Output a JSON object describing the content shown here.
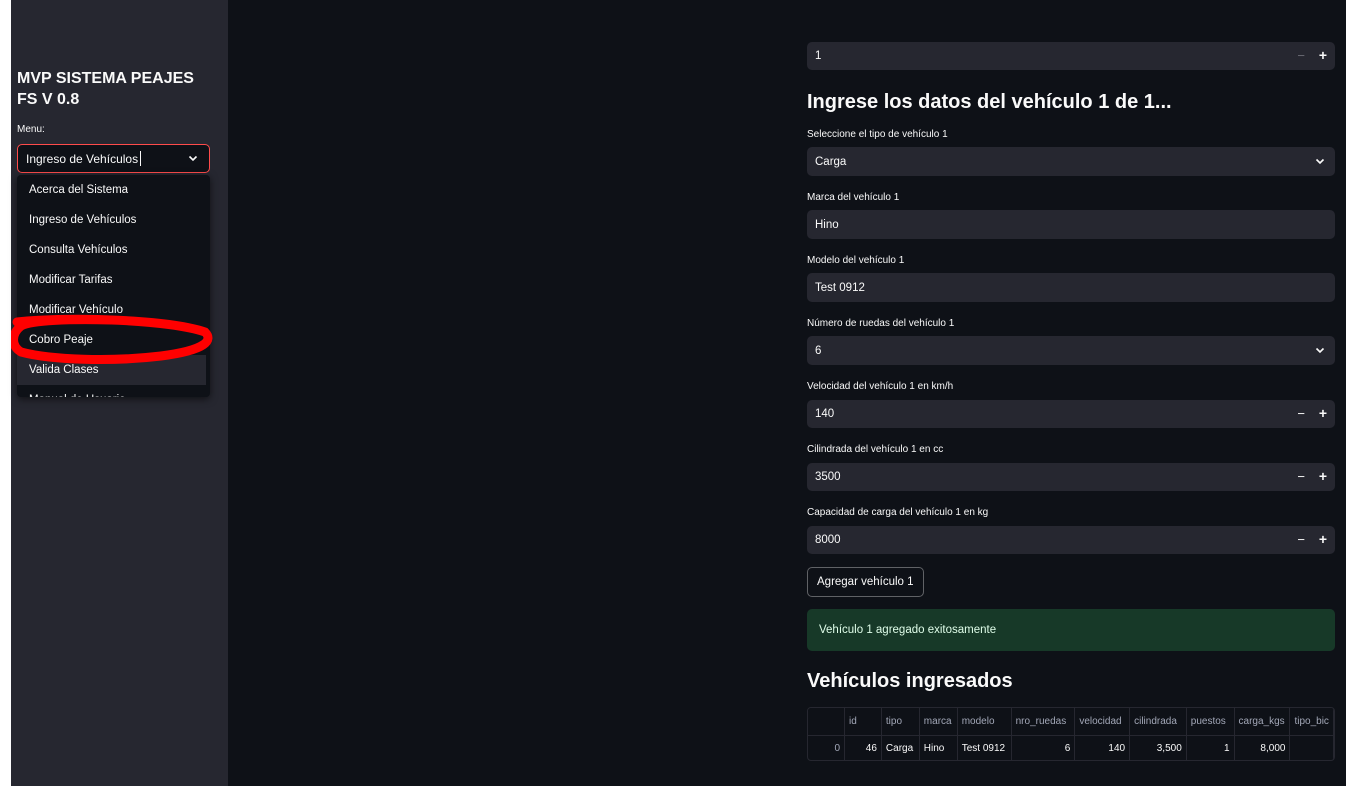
{
  "sidebar": {
    "title": "MVP SISTEMA PEAJES FS V 0.8",
    "menu_label": "Menu:",
    "selected": "Ingreso de Vehículos",
    "options": [
      "Acerca del Sistema",
      "Ingreso de Vehículos",
      "Consulta Vehículos",
      "Modificar Tarifas",
      "Modificar Vehículo",
      "Cobro Peaje",
      "Valida Clases",
      "Manual de Usuario"
    ]
  },
  "main": {
    "count_value": "1",
    "heading": "Ingrese los datos del vehículo 1 de 1...",
    "fields": {
      "tipo": {
        "label": "Seleccione el tipo de vehículo 1",
        "value": "Carga"
      },
      "marca": {
        "label": "Marca del vehículo 1",
        "value": "Hino"
      },
      "modelo": {
        "label": "Modelo del vehículo 1",
        "value": "Test 0912"
      },
      "ruedas": {
        "label": "Número de ruedas del vehículo 1",
        "value": "6"
      },
      "velocidad": {
        "label": "Velocidad del vehículo 1 en km/h",
        "value": "140"
      },
      "cilindrada": {
        "label": "Cilindrada del vehículo 1 en cc",
        "value": "3500"
      },
      "carga": {
        "label": "Capacidad de carga del vehículo 1 en kg",
        "value": "8000"
      }
    },
    "add_button": "Agregar vehículo 1",
    "success_message": "Vehículo 1 agregado exitosamente",
    "table_heading": "Vehículos ingresados",
    "table": {
      "columns": [
        "",
        "id",
        "tipo",
        "marca",
        "modelo",
        "nro_ruedas",
        "velocidad",
        "cilindrada",
        "puestos",
        "carga_kgs",
        "tipo_bic"
      ],
      "rows": [
        [
          "0",
          "46",
          "Carga",
          "Hino",
          "Test 0912",
          "6",
          "140",
          "3,500",
          "1",
          "8,000",
          ""
        ]
      ]
    }
  },
  "icons": {
    "minus": "−",
    "plus": "+",
    "chevron": "chevron-down-icon"
  },
  "colors": {
    "app_bg": "#0e1117",
    "sidebar_bg": "#262730",
    "input_bg": "#262730",
    "focus_border": "#ff4b4b",
    "success_bg": "#173928",
    "annotation": "#ff0000"
  }
}
